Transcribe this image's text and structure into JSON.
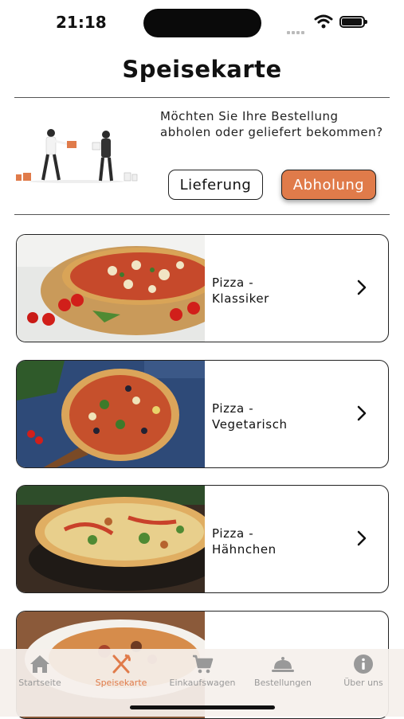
{
  "status_bar": {
    "time": "21:18"
  },
  "page": {
    "title": "Speisekarte"
  },
  "delivery": {
    "prompt": "Möchten Sie Ihre Bestellung abholen oder geliefert bekommen?",
    "delivery_label": "Lieferung",
    "pickup_label": "Abholung"
  },
  "menu": {
    "items": [
      {
        "line1": "Pizza -",
        "line2": "Klassiker"
      },
      {
        "line1": "Pizza -",
        "line2": "Vegetarisch"
      },
      {
        "line1": "Pizza -",
        "line2": "Hähnchen"
      }
    ]
  },
  "tabbar": {
    "items": [
      {
        "label": "Startseite",
        "icon": "home-icon"
      },
      {
        "label": "Speisekarte",
        "icon": "fork-knife-icon"
      },
      {
        "label": "Einkaufswagen",
        "icon": "cart-icon"
      },
      {
        "label": "Bestellungen",
        "icon": "cloche-icon"
      },
      {
        "label": "Über uns",
        "icon": "info-icon"
      }
    ],
    "active_index": 1
  },
  "colors": {
    "accent": "#e07b4a",
    "inactive_tab": "#999999",
    "text": "#111111"
  }
}
